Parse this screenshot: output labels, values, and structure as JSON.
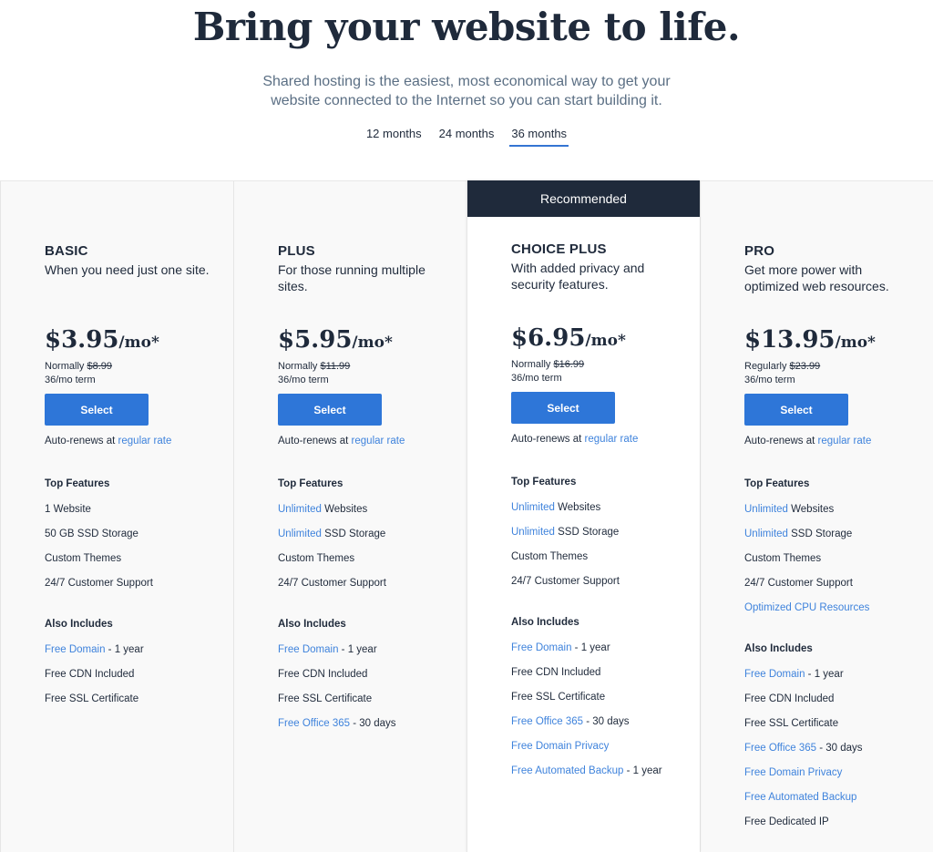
{
  "hero": {
    "title": "Bring your website to life.",
    "subtitle": "Shared hosting is the easiest, most economical way to get your website connected to the Internet so you can start building it."
  },
  "term_tabs": [
    {
      "label": "12 months",
      "active": false
    },
    {
      "label": "24 months",
      "active": false
    },
    {
      "label": "36 months",
      "active": true
    }
  ],
  "colors": {
    "navy": "#1f2a3b",
    "accent_blue": "#2e76d8",
    "link_blue": "#3f83dc",
    "panel_bg": "#f9f9f9"
  },
  "plans": [
    {
      "name": "BASIC",
      "description": "When you need just one site.",
      "recommended": false,
      "price": "$3.95",
      "price_unit": "/mo*",
      "normal_label": "Normally ",
      "normal_price": "$8.99",
      "term": "36/mo term",
      "select_label": "Select",
      "renew_text": "Auto-renews at ",
      "renew_link": "regular rate",
      "top_features_title": "Top Features",
      "top_features": [
        {
          "link": "",
          "text": "1 Website"
        },
        {
          "link": "",
          "text": "50 GB SSD Storage"
        },
        {
          "link": "",
          "text": "Custom Themes"
        },
        {
          "link": "",
          "text": "24/7 Customer Support"
        }
      ],
      "also_title": "Also Includes",
      "also": [
        {
          "link": "Free Domain",
          "text": " - 1 year"
        },
        {
          "link": "",
          "text": "Free CDN Included"
        },
        {
          "link": "",
          "text": "Free SSL Certificate"
        }
      ]
    },
    {
      "name": "PLUS",
      "description": "For those running multiple sites.",
      "recommended": false,
      "price": "$5.95",
      "price_unit": "/mo*",
      "normal_label": "Normally ",
      "normal_price": "$11.99",
      "term": "36/mo term",
      "select_label": "Select",
      "renew_text": "Auto-renews at ",
      "renew_link": "regular rate",
      "top_features_title": "Top Features",
      "top_features": [
        {
          "link": "Unlimited",
          "text": " Websites"
        },
        {
          "link": "Unlimited",
          "text": " SSD Storage"
        },
        {
          "link": "",
          "text": "Custom Themes"
        },
        {
          "link": "",
          "text": "24/7 Customer Support"
        }
      ],
      "also_title": "Also Includes",
      "also": [
        {
          "link": "Free Domain",
          "text": " - 1 year"
        },
        {
          "link": "",
          "text": "Free CDN Included"
        },
        {
          "link": "",
          "text": "Free SSL Certificate"
        },
        {
          "link": "Free Office 365",
          "text": " - 30 days"
        }
      ]
    },
    {
      "name": "CHOICE PLUS",
      "description": "With added privacy and security features.",
      "recommended": true,
      "recommended_label": "Recommended",
      "price": "$6.95",
      "price_unit": "/mo*",
      "normal_label": "Normally ",
      "normal_price": "$16.99",
      "term": "36/mo term",
      "select_label": "Select",
      "renew_text": "Auto-renews at ",
      "renew_link": "regular rate",
      "top_features_title": "Top Features",
      "top_features": [
        {
          "link": "Unlimited",
          "text": " Websites"
        },
        {
          "link": "Unlimited",
          "text": " SSD Storage"
        },
        {
          "link": "",
          "text": "Custom Themes"
        },
        {
          "link": "",
          "text": "24/7 Customer Support"
        }
      ],
      "also_title": "Also Includes",
      "also": [
        {
          "link": "Free Domain",
          "text": " - 1 year"
        },
        {
          "link": "",
          "text": "Free CDN Included"
        },
        {
          "link": "",
          "text": "Free SSL Certificate"
        },
        {
          "link": "Free Office 365",
          "text": " - 30 days"
        },
        {
          "link": "Free Domain Privacy",
          "text": ""
        },
        {
          "link": "Free Automated Backup",
          "text": " - 1 year"
        }
      ]
    },
    {
      "name": "PRO",
      "description": "Get more power with optimized web resources.",
      "recommended": false,
      "price": "$13.95",
      "price_unit": "/mo*",
      "normal_label": "Regularly ",
      "normal_price": "$23.99",
      "term": "36/mo term",
      "select_label": "Select",
      "renew_text": "Auto-renews at ",
      "renew_link": "regular rate",
      "top_features_title": "Top Features",
      "top_features": [
        {
          "link": "Unlimited",
          "text": " Websites"
        },
        {
          "link": "Unlimited",
          "text": " SSD Storage"
        },
        {
          "link": "",
          "text": "Custom Themes"
        },
        {
          "link": "",
          "text": "24/7 Customer Support"
        },
        {
          "link": "Optimized CPU Resources",
          "text": ""
        }
      ],
      "also_title": "Also Includes",
      "also": [
        {
          "link": "Free Domain",
          "text": " - 1 year"
        },
        {
          "link": "",
          "text": "Free CDN Included"
        },
        {
          "link": "",
          "text": "Free SSL Certificate"
        },
        {
          "link": "Free Office 365",
          "text": " - 30 days"
        },
        {
          "link": "Free Domain Privacy",
          "text": ""
        },
        {
          "link": "Free Automated Backup",
          "text": ""
        },
        {
          "link": "",
          "text": "Free Dedicated IP"
        }
      ]
    }
  ]
}
